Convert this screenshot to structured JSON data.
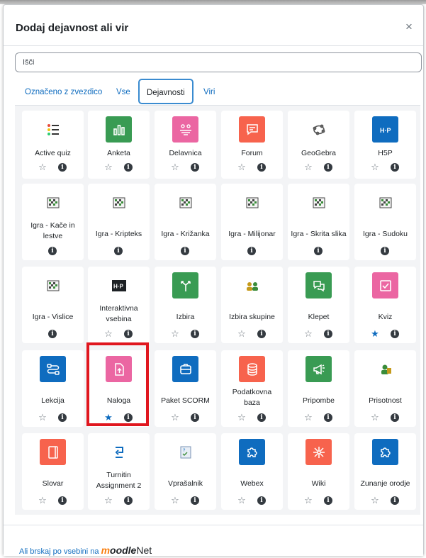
{
  "dialog": {
    "title": "Dodaj dejavnost ali vir",
    "close_glyph": "×"
  },
  "search": {
    "placeholder": "Išči"
  },
  "tabs": [
    {
      "label": "Označeno z zvezdico",
      "active": false
    },
    {
      "label": "Vse",
      "active": false
    },
    {
      "label": "Dejavnosti",
      "active": true
    },
    {
      "label": "Viri",
      "active": false
    }
  ],
  "items": [
    {
      "name": [
        "Active quiz"
      ],
      "icon": "list-icon",
      "color": "#ffffff",
      "starred": false,
      "has_star": true
    },
    {
      "name": [
        "Anketa"
      ],
      "icon": "bar-chart-icon",
      "color": "#399b53",
      "starred": false,
      "has_star": true
    },
    {
      "name": [
        "Delavnica"
      ],
      "icon": "people-icon",
      "color": "#eb66a2",
      "starred": false,
      "has_star": true
    },
    {
      "name": [
        "Forum"
      ],
      "icon": "chat-icon",
      "color": "#f7634d",
      "starred": false,
      "has_star": true
    },
    {
      "name": [
        "GeoGebra"
      ],
      "icon": "geogebra-icon",
      "color": "#ffffff",
      "starred": false,
      "has_star": true
    },
    {
      "name": [
        "H5P"
      ],
      "icon": "h5p-icon",
      "color": "#0f6cbf",
      "starred": false,
      "has_star": true
    },
    {
      "name": [
        "Igra - Kače in",
        "lestve"
      ],
      "icon": "game-icon",
      "color": "#ffffff",
      "starred": false,
      "has_star": false
    },
    {
      "name": [
        "Igra - Kripteks"
      ],
      "icon": "game-icon",
      "color": "#ffffff",
      "starred": false,
      "has_star": false
    },
    {
      "name": [
        "Igra - Križanka"
      ],
      "icon": "game-icon",
      "color": "#ffffff",
      "starred": false,
      "has_star": false
    },
    {
      "name": [
        "Igra - Milijonar"
      ],
      "icon": "game-icon",
      "color": "#ffffff",
      "starred": false,
      "has_star": false
    },
    {
      "name": [
        "Igra - Skrita slika"
      ],
      "icon": "game-icon",
      "color": "#ffffff",
      "starred": false,
      "has_star": false
    },
    {
      "name": [
        "Igra - Sudoku"
      ],
      "icon": "game-icon",
      "color": "#ffffff",
      "starred": false,
      "has_star": false
    },
    {
      "name": [
        "Igra - Vislice"
      ],
      "icon": "game-icon",
      "color": "#ffffff",
      "starred": false,
      "has_star": false
    },
    {
      "name": [
        "Interaktivna",
        "vsebina"
      ],
      "icon": "h5p-dark-icon",
      "color": "#ffffff",
      "starred": false,
      "has_star": true
    },
    {
      "name": [
        "Izbira"
      ],
      "icon": "choice-icon",
      "color": "#399b53",
      "starred": false,
      "has_star": true
    },
    {
      "name": [
        "Izbira skupine"
      ],
      "icon": "group-icon",
      "color": "#ffffff",
      "starred": false,
      "has_star": true
    },
    {
      "name": [
        "Klepet"
      ],
      "icon": "chat-bubbles-icon",
      "color": "#399b53",
      "starred": false,
      "has_star": true
    },
    {
      "name": [
        "Kviz"
      ],
      "icon": "checkbox-icon",
      "color": "#eb66a2",
      "starred": true,
      "has_star": true
    },
    {
      "name": [
        "Lekcija"
      ],
      "icon": "lesson-icon",
      "color": "#0f6cbf",
      "starred": false,
      "has_star": true
    },
    {
      "name": [
        "Naloga"
      ],
      "icon": "upload-icon",
      "color": "#eb66a2",
      "starred": true,
      "has_star": true
    },
    {
      "name": [
        "Paket SCORM"
      ],
      "icon": "package-icon",
      "color": "#0f6cbf",
      "starred": false,
      "has_star": true
    },
    {
      "name": [
        "Podatkovna",
        "baza"
      ],
      "icon": "database-icon",
      "color": "#f7634d",
      "starred": false,
      "has_star": true
    },
    {
      "name": [
        "Pripombe"
      ],
      "icon": "megaphone-icon",
      "color": "#399b53",
      "starred": false,
      "has_star": true
    },
    {
      "name": [
        "Prisotnost"
      ],
      "icon": "attendance-icon",
      "color": "#ffffff",
      "starred": false,
      "has_star": true
    },
    {
      "name": [
        "Slovar"
      ],
      "icon": "book-icon",
      "color": "#f7634d",
      "starred": false,
      "has_star": true
    },
    {
      "name": [
        "Turnitin",
        "Assignment 2"
      ],
      "icon": "turnitin-icon",
      "color": "#ffffff",
      "starred": false,
      "has_star": true
    },
    {
      "name": [
        "Vprašalnik"
      ],
      "icon": "questionnaire-icon",
      "color": "#ffffff",
      "starred": false,
      "has_star": true
    },
    {
      "name": [
        "Webex"
      ],
      "icon": "puzzle-icon",
      "color": "#0f6cbf",
      "starred": false,
      "has_star": true
    },
    {
      "name": [
        "Wiki"
      ],
      "icon": "wiki-icon",
      "color": "#f7634d",
      "starred": false,
      "has_star": true
    },
    {
      "name": [
        "Zunanje orodje"
      ],
      "icon": "puzzle-icon",
      "color": "#0f6cbf",
      "starred": false,
      "has_star": true
    }
  ],
  "glyphs": {
    "star_empty": "☆",
    "star_full": "★",
    "info": "i"
  },
  "colors": {
    "star_active": "#0f6cbf",
    "highlight": "#e0171f",
    "link": "#0f6cbf"
  },
  "footer": {
    "link_prefix": "Ali brskaj po vsebini na ",
    "brand_m": "m",
    "brand_oodle": "oodle",
    "brand_net": "Net"
  }
}
